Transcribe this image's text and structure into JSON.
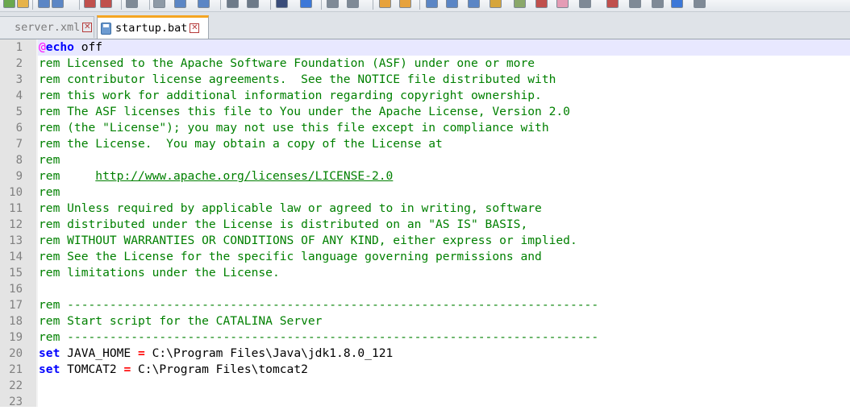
{
  "tabs": [
    {
      "label": "server.xml",
      "active": false
    },
    {
      "label": "startup.bat",
      "active": true
    }
  ],
  "toolbar": {
    "icons": [
      "new-icon",
      "open-icon",
      "save-icon",
      "save-all-icon",
      "close-icon",
      "close-all-icon",
      "print-icon",
      "cut-icon",
      "copy-icon",
      "paste-icon",
      "undo-icon",
      "redo-icon",
      "find-icon",
      "replace-icon",
      "zoom-in-icon",
      "zoom-out-icon",
      "sync-vertical-icon",
      "sync-horizontal-icon",
      "word-wrap-icon",
      "show-all-chars-icon",
      "indent-guide-icon",
      "udl-icon",
      "doc-map-icon",
      "function-list-icon",
      "folder-workspace-icon",
      "monitoring-icon",
      "record-macro-icon",
      "stop-macro-icon",
      "play-macro-icon",
      "run-macro-icon",
      "save-macro-icon"
    ]
  },
  "colors": {
    "comment": "#008000",
    "keyword": "#0000ff",
    "operator": "#ff0000",
    "at_sign": "#ff00ff",
    "current_line": "#e8e8ff",
    "tab_accent": "#f5a623"
  },
  "editor": {
    "lines": [
      {
        "num": "1",
        "segments": [
          {
            "t": "@",
            "c": "at"
          },
          {
            "t": "echo",
            "c": "kw"
          },
          {
            "t": " off",
            "c": "plain"
          }
        ],
        "current": true
      },
      {
        "num": "2",
        "segments": [
          {
            "t": "rem Licensed to the Apache Software Foundation (ASF) under one or more",
            "c": "rem"
          }
        ]
      },
      {
        "num": "3",
        "segments": [
          {
            "t": "rem contributor license agreements.  See the NOTICE file distributed with",
            "c": "rem"
          }
        ]
      },
      {
        "num": "4",
        "segments": [
          {
            "t": "rem this work for additional information regarding copyright ownership.",
            "c": "rem"
          }
        ]
      },
      {
        "num": "5",
        "segments": [
          {
            "t": "rem The ASF licenses this file to You under the Apache License, Version 2.0",
            "c": "rem"
          }
        ]
      },
      {
        "num": "6",
        "segments": [
          {
            "t": "rem (the \"License\"); you may not use this file except in compliance with",
            "c": "rem"
          }
        ]
      },
      {
        "num": "7",
        "segments": [
          {
            "t": "rem the License.  You may obtain a copy of the License at",
            "c": "rem"
          }
        ]
      },
      {
        "num": "8",
        "segments": [
          {
            "t": "rem",
            "c": "rem"
          }
        ]
      },
      {
        "num": "9",
        "segments": [
          {
            "t": "rem     ",
            "c": "rem"
          },
          {
            "t": "http://www.apache.org/licenses/LICENSE-2.0",
            "c": "link"
          }
        ]
      },
      {
        "num": "10",
        "segments": [
          {
            "t": "rem",
            "c": "rem"
          }
        ]
      },
      {
        "num": "11",
        "segments": [
          {
            "t": "rem Unless required by applicable law or agreed to in writing, software",
            "c": "rem"
          }
        ]
      },
      {
        "num": "12",
        "segments": [
          {
            "t": "rem distributed under the License is distributed on an \"AS IS\" BASIS,",
            "c": "rem"
          }
        ]
      },
      {
        "num": "13",
        "segments": [
          {
            "t": "rem WITHOUT WARRANTIES OR CONDITIONS OF ANY KIND, either express or implied.",
            "c": "rem"
          }
        ]
      },
      {
        "num": "14",
        "segments": [
          {
            "t": "rem See the License for the specific language governing permissions and",
            "c": "rem"
          }
        ]
      },
      {
        "num": "15",
        "segments": [
          {
            "t": "rem limitations under the License.",
            "c": "rem"
          }
        ]
      },
      {
        "num": "16",
        "segments": []
      },
      {
        "num": "17",
        "segments": [
          {
            "t": "rem ---------------------------------------------------------------------------",
            "c": "rem"
          }
        ]
      },
      {
        "num": "18",
        "segments": [
          {
            "t": "rem Start script for the CATALINA Server",
            "c": "rem"
          }
        ]
      },
      {
        "num": "19",
        "segments": [
          {
            "t": "rem ---------------------------------------------------------------------------",
            "c": "rem"
          }
        ]
      },
      {
        "num": "20",
        "segments": [
          {
            "t": "set",
            "c": "kw"
          },
          {
            "t": " JAVA_HOME ",
            "c": "plain"
          },
          {
            "t": "=",
            "c": "op"
          },
          {
            "t": " C:\\Program Files\\Java\\jdk1.8.0_121",
            "c": "plain"
          }
        ]
      },
      {
        "num": "21",
        "segments": [
          {
            "t": "set",
            "c": "kw"
          },
          {
            "t": " TOMCAT2 ",
            "c": "plain"
          },
          {
            "t": "=",
            "c": "op"
          },
          {
            "t": " C:\\Program Files\\tomcat2",
            "c": "plain"
          }
        ]
      },
      {
        "num": "22",
        "segments": []
      },
      {
        "num": "23",
        "segments": []
      }
    ]
  }
}
